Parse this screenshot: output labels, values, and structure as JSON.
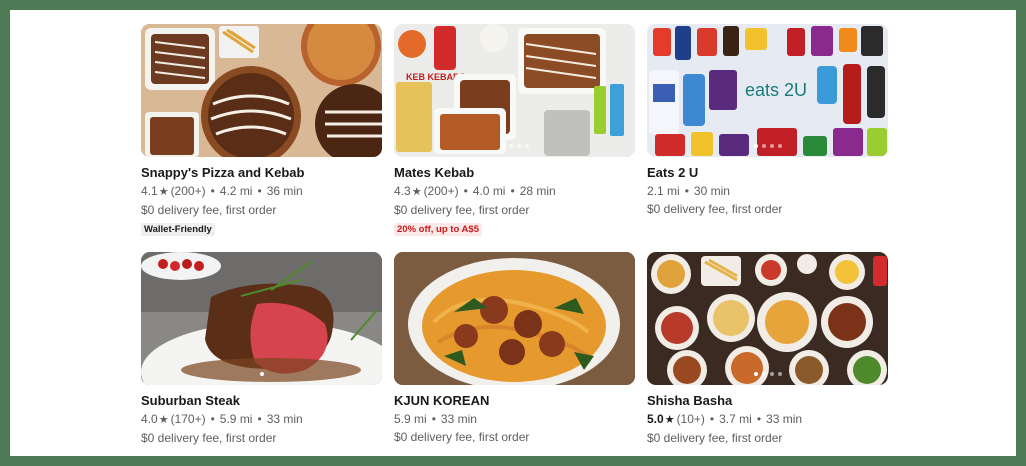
{
  "stores": [
    {
      "name": "Snappy's Pizza and Kebab",
      "rating": "4.1",
      "reviews": "(200+)",
      "distance": "4.2 mi",
      "eta": "36 min",
      "fee": "$0 delivery fee, first order",
      "badge": "Wallet-Friendly",
      "badge_color": "#efefef"
    },
    {
      "name": "Mates Kebab",
      "rating": "4.3",
      "reviews": "(200+)",
      "distance": "4.0 mi",
      "eta": "28 min",
      "fee": "$0 delivery fee, first order",
      "badge": "20% off, up to A$5",
      "badge_color": "#c91a1a",
      "image_text": "KEB KEBABS"
    },
    {
      "name": "Eats 2 U",
      "distance": "2.1 mi",
      "eta": "30 min",
      "fee": "$0 delivery fee, first order",
      "image_text": "eats 2U"
    },
    {
      "name": "Suburban Steak",
      "rating": "4.0",
      "reviews": "(170+)",
      "distance": "5.9 mi",
      "eta": "33 min",
      "fee": "$0 delivery fee, first order"
    },
    {
      "name": "KJUN KOREAN",
      "distance": "5.9 mi",
      "eta": "33 min",
      "fee": "$0 delivery fee, first order"
    },
    {
      "name": "Shisha Basha",
      "rating": "5.0",
      "reviews": "(10+)",
      "distance": "3.7 mi",
      "eta": "33 min",
      "fee": "$0 delivery fee, first order"
    }
  ],
  "icons": {
    "rating": "star-icon",
    "carousel": "carousel-dot-icon"
  },
  "colors": {
    "page_border": "#4f7a56",
    "text_primary": "#191919",
    "text_secondary": "#5e5e5e",
    "promo_red": "#c91a1a"
  }
}
